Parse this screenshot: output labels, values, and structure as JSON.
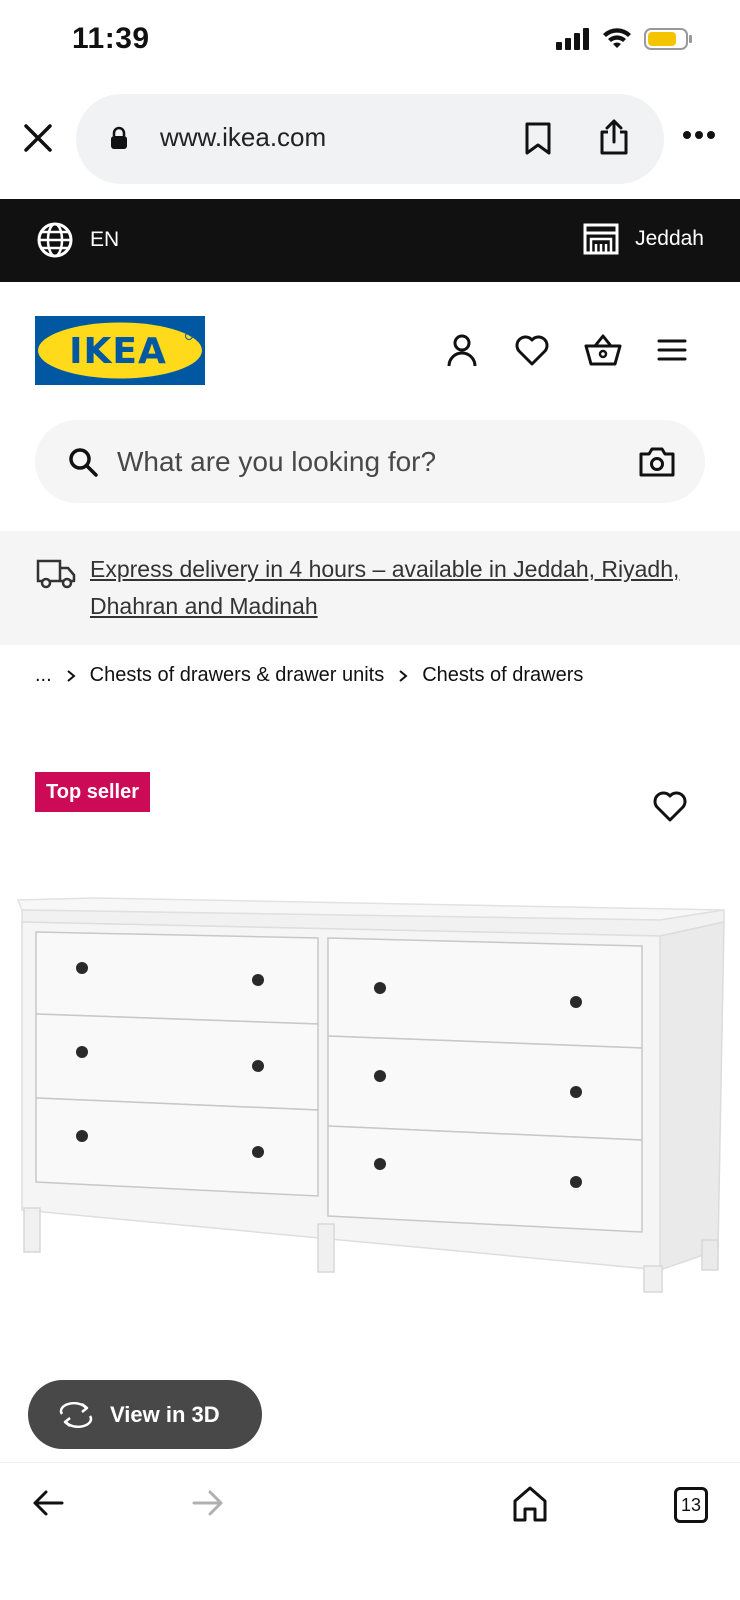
{
  "status": {
    "time": "11:39"
  },
  "browser": {
    "url": "www.ikea.com"
  },
  "top_strip": {
    "language": "EN",
    "store": "Jeddah"
  },
  "header": {
    "logo_text": "IKEA"
  },
  "search": {
    "placeholder": "What are you looking for?"
  },
  "banner": {
    "text": "Express delivery in 4 hours – available in Jeddah, Riyadh, Dhahran and Madinah"
  },
  "breadcrumb": {
    "items": [
      "...",
      "Chests of drawers & drawer units",
      "Chests of drawers"
    ]
  },
  "product": {
    "badge": "Top seller",
    "view3d_label": "View in 3D"
  },
  "bottom_nav": {
    "tab_count": "13"
  },
  "colors": {
    "ikea_blue": "#0058a3",
    "ikea_yellow": "#ffda1a",
    "badge": "#cc0a56"
  }
}
